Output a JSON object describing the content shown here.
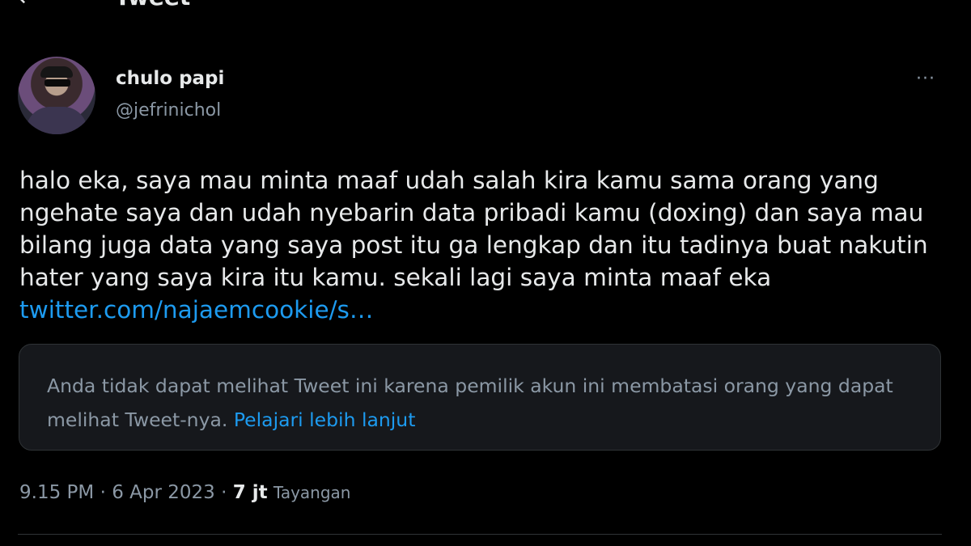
{
  "header": {
    "title": "Tweet",
    "back_icon": "arrow-left-icon"
  },
  "author": {
    "display_name": "chulo papi",
    "handle": "@jefrinichol"
  },
  "more_icon_label": "···",
  "tweet": {
    "text_lines": [
      "halo eka, saya mau minta maaf udah salah kira kamu sama orang yang",
      "ngehate saya dan udah nyebarin data pribadi kamu (doxing) dan saya mau",
      "bilang juga data yang saya post itu ga lengkap dan itu tadinya buat nakutin",
      "hater yang saya kira itu kamu. sekali lagi saya minta maaf eka"
    ],
    "link": "twitter.com/najaemcookie/s…"
  },
  "quoted_restricted": {
    "message": "Anda tidak dapat melihat Tweet ini karena pemilik akun ini membatasi orang yang dapat melihat Tweet-nya.",
    "learn_more": "Pelajari lebih lanjut"
  },
  "meta": {
    "time": "9.15 PM",
    "separator": "·",
    "date": "6 Apr 2023",
    "views_count": "7 jt",
    "views_label": "Tayangan"
  },
  "colors": {
    "link": "#1d9bf0",
    "background": "#000000",
    "muted": "#8b98a5"
  }
}
